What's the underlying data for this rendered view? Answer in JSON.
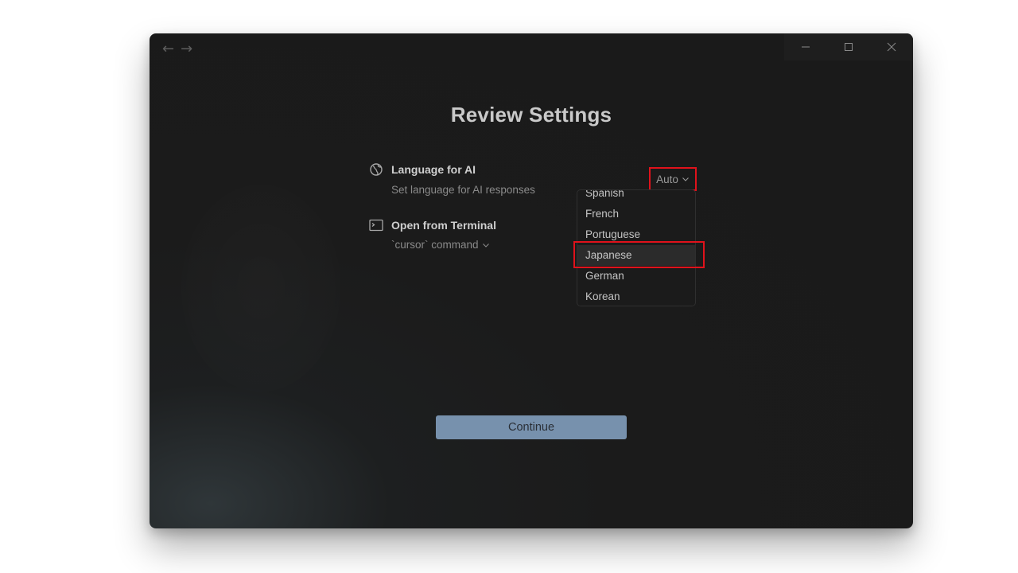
{
  "window": {
    "nav": {
      "back": "←",
      "forward": "→"
    }
  },
  "page": {
    "title": "Review Settings"
  },
  "settings": [
    {
      "label": "Language for AI",
      "description": "Set language for AI responses",
      "icon": "globe-icon"
    },
    {
      "label": "Open from Terminal",
      "description": "`cursor` command",
      "icon": "terminal-icon"
    }
  ],
  "language_select": {
    "value": "Auto",
    "options": [
      "Spanish",
      "French",
      "Portuguese",
      "Japanese",
      "German",
      "Korean"
    ],
    "highlighted": "Japanese"
  },
  "continue_button": {
    "label": "Continue"
  },
  "colors": {
    "background": "#1a1a1a",
    "accent": "#7791ad",
    "highlight": "#e0121b"
  }
}
